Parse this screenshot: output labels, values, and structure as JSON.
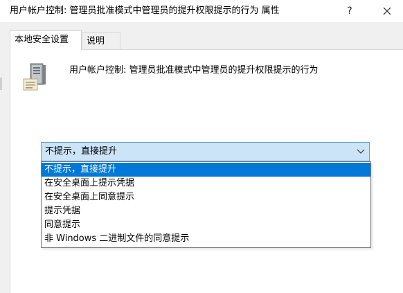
{
  "window": {
    "title": "用户帐户控制: 管理员批准模式中管理员的提升权限提示的行为 属性",
    "help_label": "?"
  },
  "tabs": [
    {
      "label": "本地安全设置",
      "active": true
    },
    {
      "label": "说明",
      "active": false
    }
  ],
  "policy": {
    "icon": "server-icon",
    "description": "用户帐户控制: 管理员批准模式中管理员的提升权限提示的行为"
  },
  "combo": {
    "selected": "不提示，直接提升",
    "options": [
      "不提示，直接提升",
      "在安全桌面上提示凭据",
      "在安全桌面上同意提示",
      "提示凭据",
      "同意提示",
      "非 Windows 二进制文件的同意提示"
    ],
    "highlight_color": "#0078d7"
  }
}
